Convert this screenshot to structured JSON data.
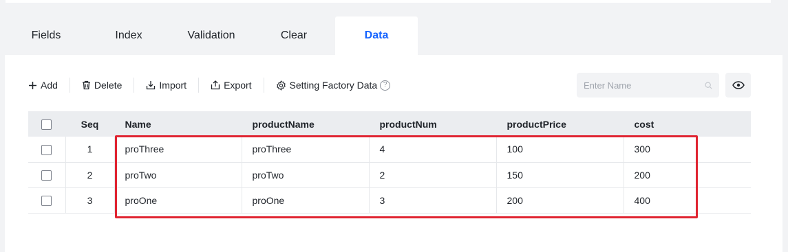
{
  "tabs": [
    {
      "label": "Fields",
      "active": false
    },
    {
      "label": "Index",
      "active": false
    },
    {
      "label": "Validation",
      "active": false
    },
    {
      "label": "Clear",
      "active": false
    },
    {
      "label": "Data",
      "active": true
    }
  ],
  "toolbar": {
    "add_label": "Add",
    "delete_label": "Delete",
    "import_label": "Import",
    "export_label": "Export",
    "factory_label": "Setting Factory Data",
    "help_glyph": "?"
  },
  "search": {
    "placeholder": "Enter Name"
  },
  "table": {
    "columns": [
      "Seq",
      "Name",
      "productName",
      "productNum",
      "productPrice",
      "cost"
    ],
    "rows": [
      {
        "seq": "1",
        "name": "proThree",
        "productName": "proThree",
        "productNum": "4",
        "productPrice": "100",
        "cost": "300"
      },
      {
        "seq": "2",
        "name": "proTwo",
        "productName": "proTwo",
        "productNum": "2",
        "productPrice": "150",
        "cost": "200"
      },
      {
        "seq": "3",
        "name": "proOne",
        "productName": "proOne",
        "productNum": "3",
        "productPrice": "200",
        "cost": "400"
      }
    ]
  },
  "colors": {
    "accent": "#1664ff",
    "highlight": "#e02431"
  }
}
